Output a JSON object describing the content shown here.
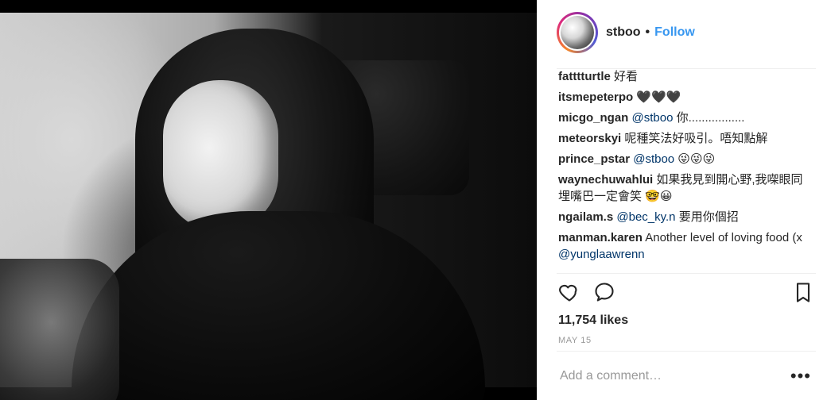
{
  "post": {
    "username": "stboo",
    "follow_label": "Follow",
    "separator": "•",
    "likes_text": "11,754 likes",
    "date_text": "MAY 15",
    "add_comment_placeholder": "Add a comment…",
    "more_glyph": "•••",
    "icons": {
      "avatar": "profile-avatar",
      "like": "heart-icon",
      "comment": "comment-icon",
      "save": "bookmark-icon",
      "more": "more-icon"
    },
    "colors": {
      "link": "#3897f0",
      "mention": "#003569",
      "text": "#262626",
      "muted": "#999999",
      "divider": "#efefef"
    }
  },
  "comments": [
    {
      "user": "fatttturtle",
      "parts": [
        {
          "t": "text",
          "v": " 好看"
        }
      ]
    },
    {
      "user": "itsmepeterpo",
      "parts": [
        {
          "t": "text",
          "v": " 🖤🖤🖤"
        }
      ]
    },
    {
      "user": "micgo_ngan",
      "parts": [
        {
          "t": "text",
          "v": " "
        },
        {
          "t": "mention",
          "v": "@stboo"
        },
        {
          "t": "text",
          "v": " 你................."
        }
      ]
    },
    {
      "user": "meteorskyi",
      "parts": [
        {
          "t": "text",
          "v": " 呢種笑法好吸引。唔知點解"
        }
      ]
    },
    {
      "user": "prince_pstar",
      "parts": [
        {
          "t": "text",
          "v": " "
        },
        {
          "t": "mention",
          "v": "@stboo"
        },
        {
          "t": "text",
          "v": " 😜😜😜"
        }
      ]
    },
    {
      "user": "waynechuwahlui",
      "parts": [
        {
          "t": "text",
          "v": " 如果我見到開心野,我㗎眼同埋嘴巴一定會笑 🤓😀"
        }
      ]
    },
    {
      "user": "ngailam.s",
      "parts": [
        {
          "t": "text",
          "v": " "
        },
        {
          "t": "mention",
          "v": "@bec_ky.n"
        },
        {
          "t": "text",
          "v": " 要用你個招"
        }
      ]
    },
    {
      "user": "manman.karen",
      "parts": [
        {
          "t": "text",
          "v": " Another level of loving food (x "
        },
        {
          "t": "mention",
          "v": "@yunglaawrenn"
        }
      ]
    }
  ]
}
